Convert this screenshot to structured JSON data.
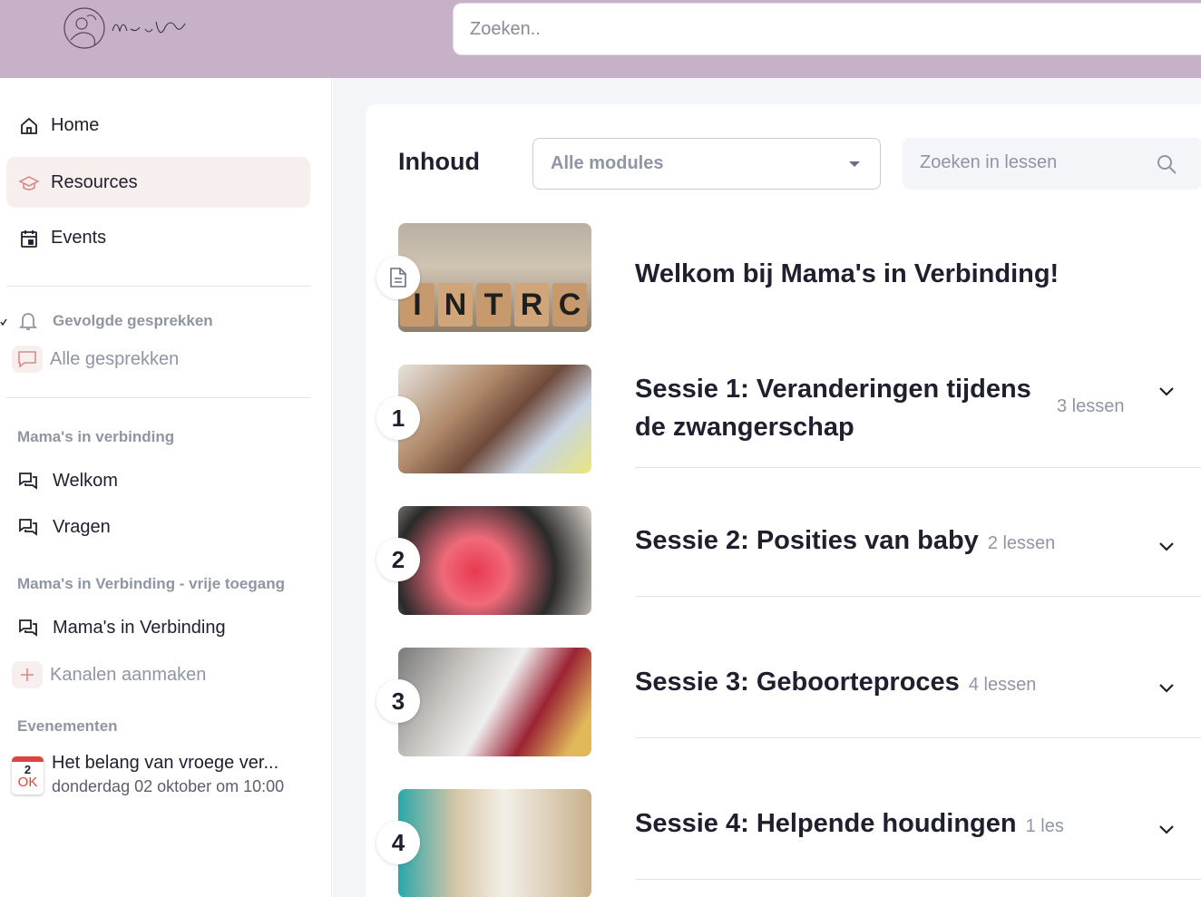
{
  "header": {
    "search_placeholder": "Zoeken.."
  },
  "sidebar": {
    "nav": [
      {
        "label": "Home",
        "icon": "home-icon"
      },
      {
        "label": "Resources",
        "icon": "graduation-cap-icon",
        "active": true
      },
      {
        "label": "Events",
        "icon": "calendar-icon"
      }
    ],
    "followed_label": "Gevolgde gesprekken",
    "all_label": "Alle gesprekken",
    "section1_title": "Mama's in verbinding",
    "section1_channels": [
      "Welkom",
      "Vragen"
    ],
    "section2_title": "Mama's in Verbinding - vrije toegang",
    "section2_channels": [
      "Mama's in Verbinding"
    ],
    "create_channels_label": "Kanalen aanmaken",
    "events_title": "Evenementen",
    "event": {
      "day": "2",
      "month": "OK",
      "title": "Het belang van vroege ver...",
      "datetime": "donderdag 02 oktober om 10:00"
    }
  },
  "main": {
    "heading": "Inhoud",
    "module_select": "Alle modules",
    "lesson_search_placeholder": "Zoeken in lessen",
    "intro_title": "Welkom bij Mama's in Verbinding!",
    "sessions": [
      {
        "num": "1",
        "title_line1": "Sessie 1: Veranderingen tijdens",
        "title_line2": "de zwangerschap",
        "count": "3 lessen"
      },
      {
        "num": "2",
        "title": "Sessie 2: Posities van baby",
        "count": "2 lessen"
      },
      {
        "num": "3",
        "title": "Sessie 3: Geboorteproces",
        "count": "4 lessen"
      },
      {
        "num": "4",
        "title": "Sessie 4: Helpende houdingen",
        "count": "1 les"
      }
    ],
    "intro_blocks": [
      "I",
      "N",
      "T",
      "R",
      "C"
    ]
  },
  "colors": {
    "header": "#c7b1c9",
    "active_nav": "#f7efee",
    "accent_pink": "#d98a8a",
    "muted": "#8f95a3"
  }
}
